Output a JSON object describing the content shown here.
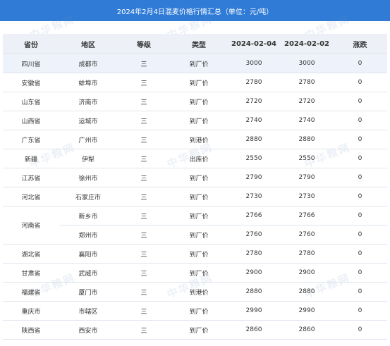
{
  "title": "2024年2月4日混麦价格行情汇总（单位：元/吨）",
  "headers": [
    "省份",
    "地区",
    "等级",
    "类型",
    "2024-02-04",
    "2024-02-02",
    "涨跌"
  ],
  "watermark_text": "中华粮网",
  "rows": [
    {
      "province": "四川省",
      "region": "成都市",
      "grade": "三",
      "type": "到厂价",
      "p1": "3000",
      "p2": "3000",
      "chg": "0"
    },
    {
      "province": "安徽省",
      "region": "蚌埠市",
      "grade": "三",
      "type": "到厂价",
      "p1": "2780",
      "p2": "2780",
      "chg": "0"
    },
    {
      "province": "山东省",
      "region": "济南市",
      "grade": "三",
      "type": "到厂价",
      "p1": "2720",
      "p2": "2720",
      "chg": "0"
    },
    {
      "province": "山西省",
      "region": "运城市",
      "grade": "三",
      "type": "到厂价",
      "p1": "2740",
      "p2": "2740",
      "chg": "0"
    },
    {
      "province": "广东省",
      "region": "广州市",
      "grade": "三",
      "type": "到港价",
      "p1": "2880",
      "p2": "2880",
      "chg": "0"
    },
    {
      "province": "新疆",
      "region": "伊犁",
      "grade": "三",
      "type": "出库价",
      "p1": "2550",
      "p2": "2550",
      "chg": "0"
    },
    {
      "province": "江苏省",
      "region": "徐州市",
      "grade": "三",
      "type": "到厂价",
      "p1": "2790",
      "p2": "2790",
      "chg": "0"
    },
    {
      "province": "河北省",
      "region": "石家庄市",
      "grade": "三",
      "type": "到厂价",
      "p1": "2730",
      "p2": "2730",
      "chg": "0"
    },
    {
      "province": "河南省",
      "region": "新乡市",
      "grade": "三",
      "type": "到厂价",
      "p1": "2766",
      "p2": "2766",
      "chg": "0"
    },
    {
      "province": "",
      "region": "郑州市",
      "grade": "三",
      "type": "到厂价",
      "p1": "2760",
      "p2": "2760",
      "chg": "0"
    },
    {
      "province": "湖北省",
      "region": "襄阳市",
      "grade": "三",
      "type": "到厂价",
      "p1": "2780",
      "p2": "2780",
      "chg": "0"
    },
    {
      "province": "甘肃省",
      "region": "武威市",
      "grade": "三",
      "type": "到厂价",
      "p1": "2900",
      "p2": "2900",
      "chg": "0"
    },
    {
      "province": "福建省",
      "region": "厦门市",
      "grade": "三",
      "type": "到港价",
      "p1": "2880",
      "p2": "2880",
      "chg": "0"
    },
    {
      "province": "重庆市",
      "region": "市辖区",
      "grade": "三",
      "type": "到厂价",
      "p1": "2990",
      "p2": "2990",
      "chg": "0"
    },
    {
      "province": "陕西省",
      "region": "西安市",
      "grade": "三",
      "type": "到厂价",
      "p1": "2860",
      "p2": "2860",
      "chg": "0"
    }
  ]
}
